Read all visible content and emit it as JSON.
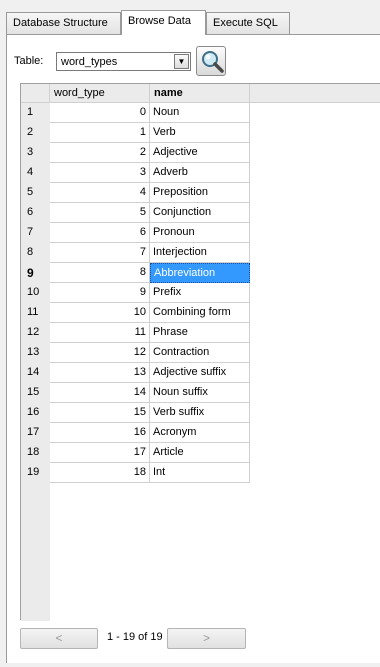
{
  "tabs": [
    {
      "label": "Database Structure",
      "active": false
    },
    {
      "label": "Browse Data",
      "active": true
    },
    {
      "label": "Execute SQL",
      "active": false
    }
  ],
  "table_selector": {
    "label": "Table:",
    "value": "word_types"
  },
  "grid": {
    "columns": [
      "word_type",
      "name"
    ],
    "current_row": 9,
    "selected_cell": {
      "row": 9,
      "column": "name"
    },
    "rows": [
      {
        "rownum": "1",
        "word_type": "0",
        "name": "Noun"
      },
      {
        "rownum": "2",
        "word_type": "1",
        "name": "Verb"
      },
      {
        "rownum": "3",
        "word_type": "2",
        "name": "Adjective"
      },
      {
        "rownum": "4",
        "word_type": "3",
        "name": "Adverb"
      },
      {
        "rownum": "5",
        "word_type": "4",
        "name": "Preposition"
      },
      {
        "rownum": "6",
        "word_type": "5",
        "name": "Conjunction"
      },
      {
        "rownum": "7",
        "word_type": "6",
        "name": "Pronoun"
      },
      {
        "rownum": "8",
        "word_type": "7",
        "name": "Interjection"
      },
      {
        "rownum": "9",
        "word_type": "8",
        "name": "Abbreviation"
      },
      {
        "rownum": "10",
        "word_type": "9",
        "name": "Prefix"
      },
      {
        "rownum": "11",
        "word_type": "10",
        "name": "Combining form"
      },
      {
        "rownum": "12",
        "word_type": "11",
        "name": "Phrase"
      },
      {
        "rownum": "13",
        "word_type": "12",
        "name": "Contraction"
      },
      {
        "rownum": "14",
        "word_type": "13",
        "name": "Adjective suffix"
      },
      {
        "rownum": "15",
        "word_type": "14",
        "name": "Noun suffix"
      },
      {
        "rownum": "16",
        "word_type": "15",
        "name": "Verb suffix"
      },
      {
        "rownum": "17",
        "word_type": "16",
        "name": "Acronym"
      },
      {
        "rownum": "18",
        "word_type": "17",
        "name": "Article"
      },
      {
        "rownum": "19",
        "word_type": "18",
        "name": "Int"
      }
    ]
  },
  "navigator": {
    "prev_label": "<",
    "next_label": ">",
    "range_label": "1 - 19 of 19"
  },
  "colors": {
    "selection": "#3399ff",
    "header_bg": "#ebebeb",
    "gridline": "#d0d0d0"
  },
  "icons": {
    "search": "magnifier-icon",
    "combo_arrow": "chevron-down-icon"
  }
}
